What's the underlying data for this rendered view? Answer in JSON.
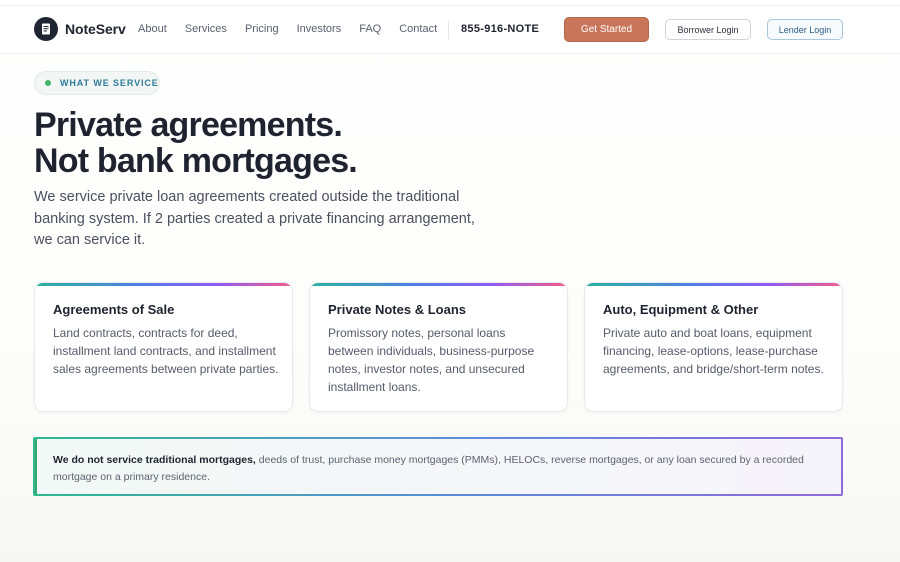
{
  "brand": {
    "name": "NoteServ"
  },
  "nav": {
    "links": [
      "About",
      "Services",
      "Pricing",
      "Investors",
      "FAQ",
      "Contact"
    ],
    "phone": "855-916-NOTE",
    "cta_label": "Get Started",
    "borrower_login": "Borrower Login",
    "lender_login": "Lender Login"
  },
  "hero": {
    "badge": "WHAT WE SERVICE",
    "title_line1": "Private agreements.",
    "title_line2": "Not bank mortgages.",
    "subtitle": "We service private loan agreements created outside the traditional banking system. If 2 parties created a private financing arrangement, we can service it."
  },
  "cards": [
    {
      "title": "Agreements of Sale",
      "body": "Land contracts, contracts for deed, installment land contracts, and installment sales agreements between private parties."
    },
    {
      "title": "Private Notes & Loans",
      "body": "Promissory notes, personal loans between individuals, business-purpose notes, investor notes, and unsecured installment loans."
    },
    {
      "title": "Auto, Equipment & Other",
      "body": "Private auto and boat loans, equipment financing, lease-options, lease-purchase agreements, and bridge/short-term notes."
    }
  ],
  "notice": {
    "strong": "We do not service traditional mortgages,",
    "text": " deeds of trust, purchase money mortgages (PMMs), HELOCs, reverse mortgages, or any loan secured by a recorded mortgage on a primary residence."
  },
  "colors": {
    "accent": "#c8755a",
    "badge_dot": "#3fb26b",
    "lender_border": "#a8c7dd",
    "text_dark": "#1f2330"
  },
  "icons": {
    "logo": "document-icon",
    "badge": "status-dot-icon"
  }
}
